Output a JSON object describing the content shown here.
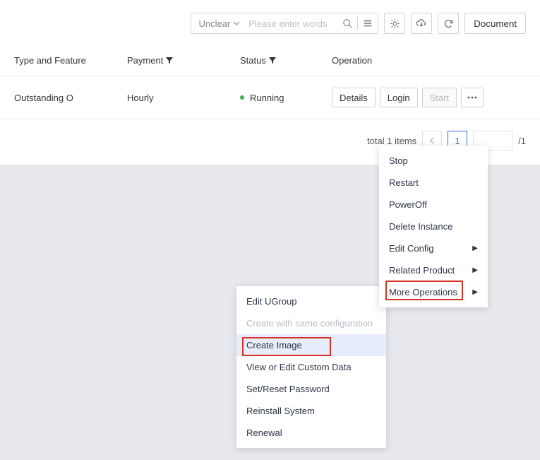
{
  "toolbar": {
    "search_select": "Unclear",
    "search_placeholder": "Please enter words",
    "document_label": "Document"
  },
  "table": {
    "headers": {
      "type": "Type and Feature",
      "payment": "Payment",
      "status": "Status",
      "operation": "Operation"
    },
    "row": {
      "type": "Outstanding O",
      "payment": "Hourly",
      "status": "Running"
    },
    "ops": {
      "details": "Details",
      "login": "Login",
      "start": "Start"
    }
  },
  "pager": {
    "total_text": "total 1 items",
    "page": "1",
    "suffix": "/1"
  },
  "menu1": {
    "stop": "Stop",
    "restart": "Restart",
    "poweroff": "PowerOff",
    "delete": "Delete Instance",
    "edit_config": "Edit Config",
    "related": "Related Product",
    "more_ops": "More Operations"
  },
  "menu2": {
    "edit_ugroup": "Edit UGroup",
    "create_same": "Create with same configuration",
    "create_image": "Create Image",
    "view_custom": "View or Edit Custom Data",
    "reset_pwd": "Set/Reset Password",
    "reinstall": "Reinstall System",
    "renewal": "Renewal"
  }
}
